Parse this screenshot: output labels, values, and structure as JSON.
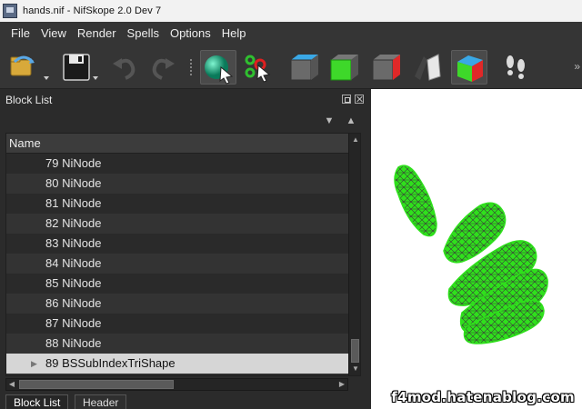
{
  "window": {
    "title": "hands.nif - NifSkope 2.0 Dev 7"
  },
  "menu": [
    "File",
    "View",
    "Render",
    "Spells",
    "Options",
    "Help"
  ],
  "toolbar": {
    "icons": [
      "load-icon",
      "save-icon",
      "undo-icon",
      "redo-icon",
      "select-object-icon",
      "select-vertex-icon",
      "view-top-icon",
      "view-front-icon",
      "view-side-icon",
      "view-flip-icon",
      "perspective-icon",
      "walk-icon"
    ],
    "overflow": "»"
  },
  "block_list": {
    "title": "Block List",
    "column_header": "Name",
    "rows": [
      {
        "label": "79 NiNode"
      },
      {
        "label": "80 NiNode"
      },
      {
        "label": "81 NiNode"
      },
      {
        "label": "82 NiNode"
      },
      {
        "label": "83 NiNode"
      },
      {
        "label": "84 NiNode"
      },
      {
        "label": "85 NiNode"
      },
      {
        "label": "86 NiNode"
      },
      {
        "label": "87 NiNode"
      },
      {
        "label": "88 NiNode"
      },
      {
        "label": "89 BSSubIndexTriShape",
        "selected": true
      }
    ]
  },
  "tabs": [
    "Block List",
    "Header"
  ],
  "viewport": {
    "mesh_color": "#2fe01c",
    "wire_color": "#3a3a3a",
    "watermark": "f4mod.hatenablog.com"
  }
}
